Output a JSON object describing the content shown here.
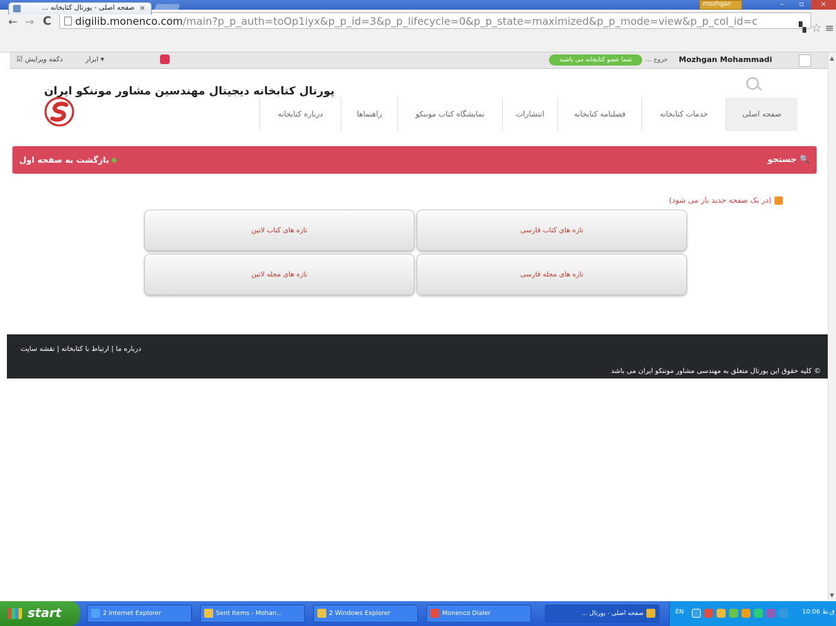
{
  "browser": {
    "tab_title": "صفحه اصلی - پورتال کتابخانه ...",
    "tab_close": "×",
    "user_badge": "mozhgan",
    "url_host": "digilib.monenco.com",
    "url_path": "/main?p_p_auth=toOp1iyx&p_p_id=3&p_p_lifecycle=0&p_p_state=maximized&p_p_mode=view&p_p_col_id=c",
    "window_min": "–",
    "window_max": "▫",
    "window_close": "×"
  },
  "dockbar": {
    "edit_controls": "دکمه ویرایش ☑",
    "tools": "▾ ابزار",
    "user_name": "Mozhgan Mohammadi",
    "signout": "خروج ...",
    "member_badge": "شما عضو کتابخانه می باشید"
  },
  "header": {
    "site_title": "پورتال کتابخانه دیجیتال مهندسین مشاور موننکو ایران",
    "nav": [
      "صفحه اصلی",
      "خدمات کتابخانه",
      "فصلنامه کتابخانه",
      "انتشارات",
      "نمایشگاه کتاب موننکو",
      "راهنماها",
      "درباره کتابخانه"
    ]
  },
  "banner": {
    "back": "بازگشت به صفحه اول",
    "explore": "جستجو"
  },
  "content": {
    "rss_note": "(در یک صفحه جدید باز می شود)",
    "tiles": {
      "persian_books": "تازه های کتاب فارسی",
      "latin_books": "تازه های کتاب لاتین",
      "persian_journals": "تازه های مجله فارسی",
      "latin_journals": "تازه های مجله لاتین"
    }
  },
  "footer": {
    "links": "درباره ما | ارتباط با کتابخانه | نقشه سایت",
    "copyright": "© کلیه حقوق این پورتال متعلق به مهندسی مشاور موننکو ایران می باشد"
  },
  "taskbar": {
    "start": "start",
    "items": [
      "2 Internet Explorer",
      "Sent Items - Mohan...",
      "2 Windows Explorer",
      "Monenco Dialer",
      "صفحه اصلی - پورتال ..."
    ],
    "lang": "EN",
    "clock": "10:06 ق.ظ"
  },
  "colors": {
    "banner": "#d9475a",
    "footer": "#24282a",
    "badge": "#6cc045"
  }
}
